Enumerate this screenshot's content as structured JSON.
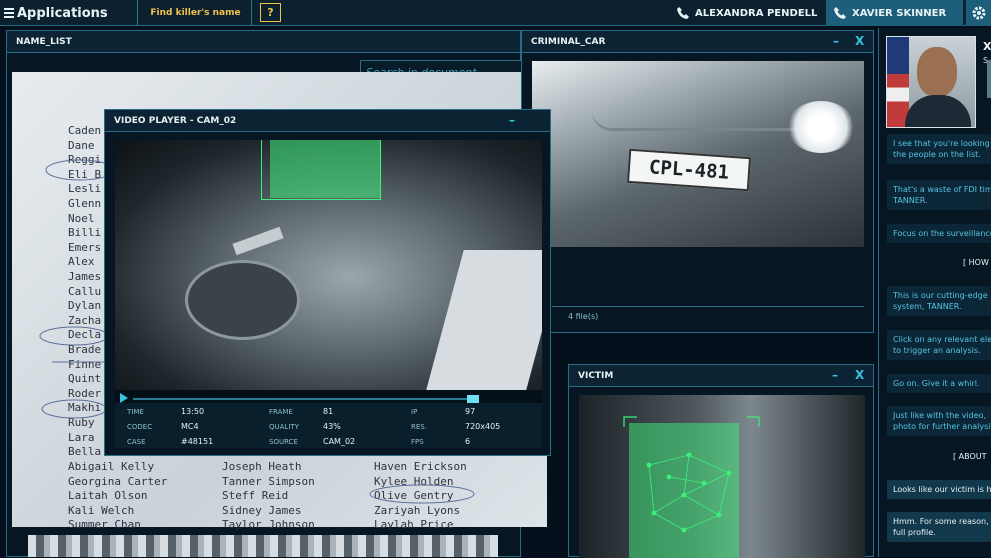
{
  "topbar": {
    "apps_label": "Applications",
    "task_label": "Find killer's name",
    "help_label": "?",
    "contact_1": "ALEXANDRA PENDELL",
    "contact_2": "XAVIER SKINNER"
  },
  "name_list": {
    "title": "NAME_LIST",
    "search_placeholder": "Search in document...",
    "names_col1": [
      "Caden",
      "Dane",
      "Reggi",
      "Eli B",
      "Lesli",
      "Glenn",
      "Noel",
      "Billi",
      "Emers",
      "Alex",
      "James",
      "Callu",
      "Dylan",
      "Zacha",
      "Decla",
      "Brade",
      "Finne",
      "Quint",
      "Roder",
      "Makhi",
      "Ruby",
      "Lara",
      "Bella",
      "Abigail Kelly",
      "Georgina Carter",
      "Laitah Olson",
      "Kali Welch",
      "Summer Chan"
    ],
    "names_col2": [
      "Joseph Heath",
      "Tanner Simpson",
      "Steff Reid",
      "Sidney James",
      "Taylor Johnson"
    ],
    "names_col3": [
      "Haven Erickson",
      "Kylee Holden",
      "Olive Gentry",
      "Zariyah Lyons",
      "Laylah Price"
    ]
  },
  "video_player": {
    "title": "VIDEO PLAYER - CAM_02",
    "minimize": "–",
    "meta": [
      {
        "k": "TIME",
        "v": "13:50"
      },
      {
        "k": "FRAME",
        "v": "81"
      },
      {
        "k": "IP",
        "v": "97"
      },
      {
        "k": "CODEC",
        "v": "MC4"
      },
      {
        "k": "QUALITY",
        "v": "43%"
      },
      {
        "k": "RES.",
        "v": "720x405"
      },
      {
        "k": "CASE",
        "v": "#48151"
      },
      {
        "k": "SOURCE",
        "v": "CAM_02"
      },
      {
        "k": "FPS",
        "v": "6"
      }
    ]
  },
  "criminal_car": {
    "title": "CRIMINAL_CAR",
    "minimize": "–",
    "close": "X",
    "plate": "CPL-481",
    "files": "4 file(s)"
  },
  "victim": {
    "title": "VICTIM",
    "minimize": "–",
    "close": "X"
  },
  "chat": {
    "name": "X",
    "sub": "S",
    "messages": [
      "I see that you're looking",
      "the people on the list.",
      "That's a waste of FDI time",
      "TANNER.",
      "Focus on the surveillance",
      "This is our cutting-edge",
      "system, TANNER.",
      "Click on any relevant ele",
      "to trigger an analysis.",
      "Go on. Give it a whirl.",
      "Just like with the video,",
      "photo for further analysi",
      "Looks like our victim is h",
      "Hmm. For some reason,",
      "full profile."
    ],
    "option_1": "[ HOW",
    "option_2": "[ ABOUT"
  },
  "colors": {
    "accent": "#38c4e0",
    "task": "#f2c14a",
    "target": "#3df07a"
  },
  "icons": [
    "hamburger-icon",
    "phone-icon",
    "gear-icon",
    "play-icon"
  ]
}
